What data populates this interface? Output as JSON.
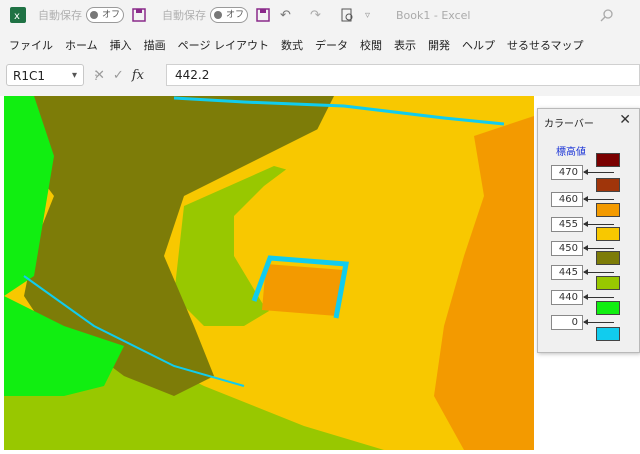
{
  "titlebar": {
    "autosave_label": "自動保存",
    "toggle_label": "オフ",
    "autosave_label_2": "自動保存",
    "toggle_label_2": "オフ",
    "doc_title": "Book1 - Excel"
  },
  "menu": [
    "ファイル",
    "ホーム",
    "挿入",
    "描画",
    "ページ レイアウト",
    "数式",
    "データ",
    "校閲",
    "表示",
    "開発",
    "ヘルプ",
    "せるせるマップ"
  ],
  "formula_bar": {
    "name_box": "R1C1",
    "formula_value": "442.2"
  },
  "colorbar": {
    "title": "カラーバー",
    "header": "標高値",
    "levels": [
      "470",
      "460",
      "455",
      "450",
      "445",
      "440",
      "0"
    ],
    "swatches": [
      "#7a0000",
      "#a0350a",
      "#f39a00",
      "#f8c800",
      "#7d7c08",
      "#98c800",
      "#11ee11",
      "#11ccee"
    ]
  },
  "map_colors": {
    "green": "#11ee11",
    "lime": "#98c800",
    "olive": "#7d7c08",
    "yellow": "#f8c800",
    "orange": "#f39a00",
    "cyan": "#11ccee"
  }
}
